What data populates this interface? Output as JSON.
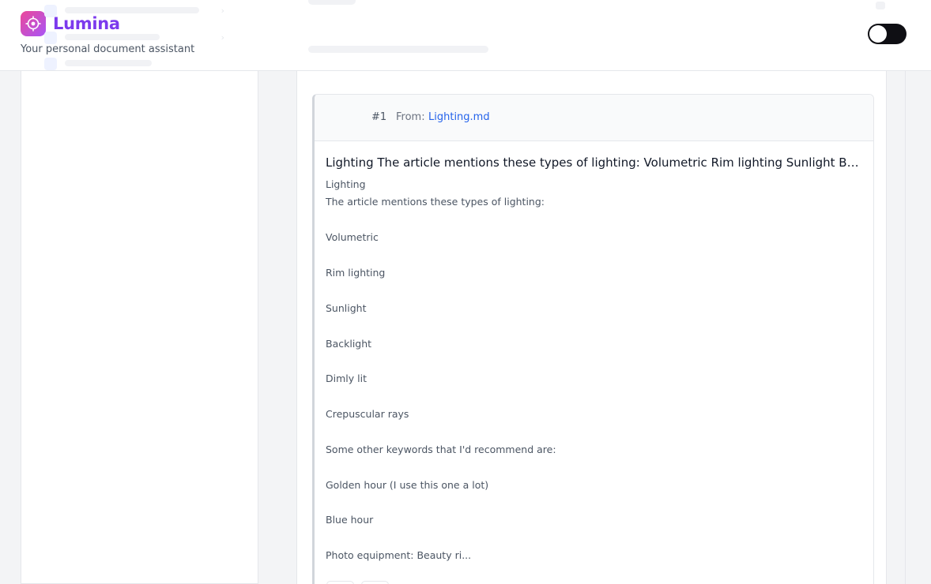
{
  "app": {
    "name": "Lumina",
    "tagline": "Your personal document assistant",
    "logo_icon": "target-icon",
    "accent": "#7c3aed",
    "logo_gradient": [
      "#ec4899",
      "#a855f7"
    ]
  },
  "theme_toggle": {
    "state": "dark",
    "knob_color": "#ffffff",
    "track_color": "#0f0f14"
  },
  "result": {
    "rank": "#1",
    "from_label": "From:",
    "source_file": "Lighting.md",
    "title": "Lighting The article mentions these types of lighting: Volumetric Rim lighting Sunlight Backl...",
    "lines": [
      "Lighting",
      "The article mentions these types of lighting:",
      "Volumetric",
      "Rim lighting",
      "Sunlight",
      "Backlight",
      "Dimly lit",
      "Crepuscular rays",
      "Some other keywords that I'd recommend are:",
      "Golden hour (I use this one a lot)",
      "Blue hour",
      "Photo equipment: Beauty ri..."
    ]
  }
}
